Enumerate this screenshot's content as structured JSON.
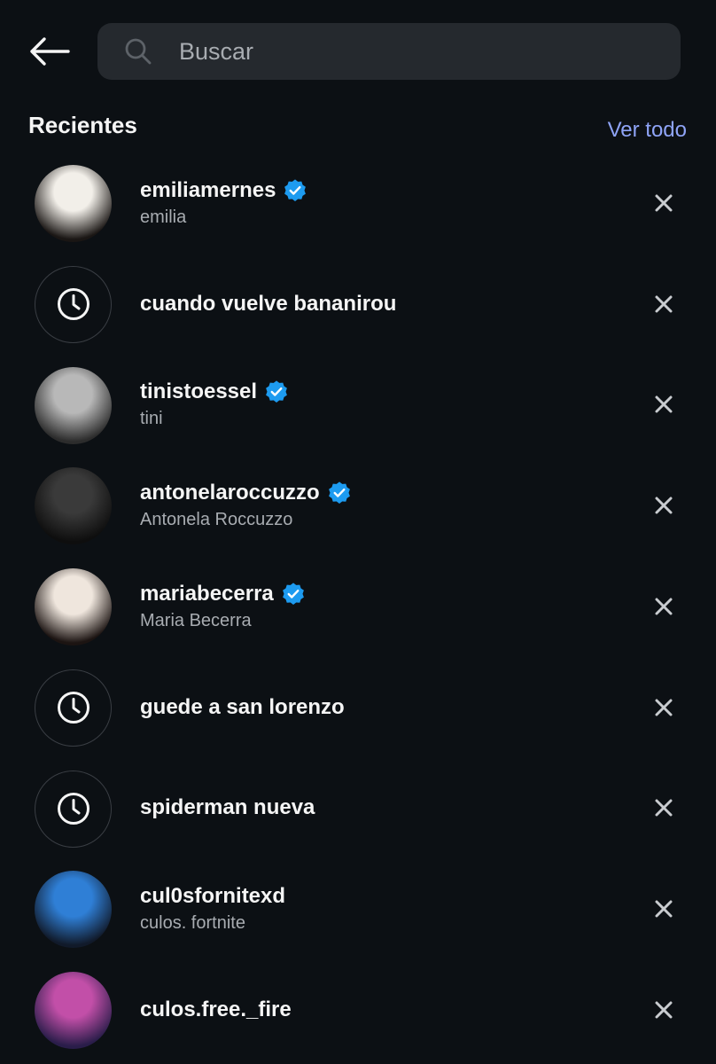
{
  "search": {
    "placeholder": "Buscar"
  },
  "recents": {
    "title": "Recientes",
    "see_all_label": "Ver todo",
    "items": [
      {
        "type": "account",
        "username": "emiliamernes",
        "name": "emilia",
        "verified": true,
        "avatar_colors": [
          "#f2efe9",
          "#1a1614"
        ]
      },
      {
        "type": "query",
        "text": "cuando vuelve bananirou"
      },
      {
        "type": "account",
        "username": "tinistoessel",
        "name": "tini",
        "verified": true,
        "avatar_colors": [
          "#b8b8b8",
          "#2c2c2c"
        ]
      },
      {
        "type": "account",
        "username": "antonelaroccuzzo",
        "name": "Antonela Roccuzzo",
        "verified": true,
        "avatar_colors": [
          "#3a3a3a",
          "#0e0e0e"
        ]
      },
      {
        "type": "account",
        "username": "mariabecerra",
        "name": "Maria Becerra",
        "verified": true,
        "avatar_colors": [
          "#efe6dd",
          "#1c1412"
        ]
      },
      {
        "type": "query",
        "text": "guede a san lorenzo"
      },
      {
        "type": "query",
        "text": "spiderman nueva"
      },
      {
        "type": "account",
        "username": "cul0sfornitexd",
        "name": "culos. fortnite",
        "verified": false,
        "avatar_colors": [
          "#2f7fd6",
          "#111a2a"
        ]
      },
      {
        "type": "account",
        "username": "culos.free._fire",
        "name": "",
        "verified": false,
        "avatar_colors": [
          "#c24fa8",
          "#2a1d4a"
        ]
      }
    ]
  },
  "colors": {
    "background": "#0c1014",
    "search_bg": "#25292e",
    "link": "#8fa4f7",
    "verified": "#1d9bf0",
    "secondary_text": "#a8acb1"
  },
  "icons": {
    "back": "arrow-left-icon",
    "search": "magnifier-icon",
    "history": "clock-icon",
    "verified": "verified-badge-icon",
    "remove": "close-icon"
  }
}
